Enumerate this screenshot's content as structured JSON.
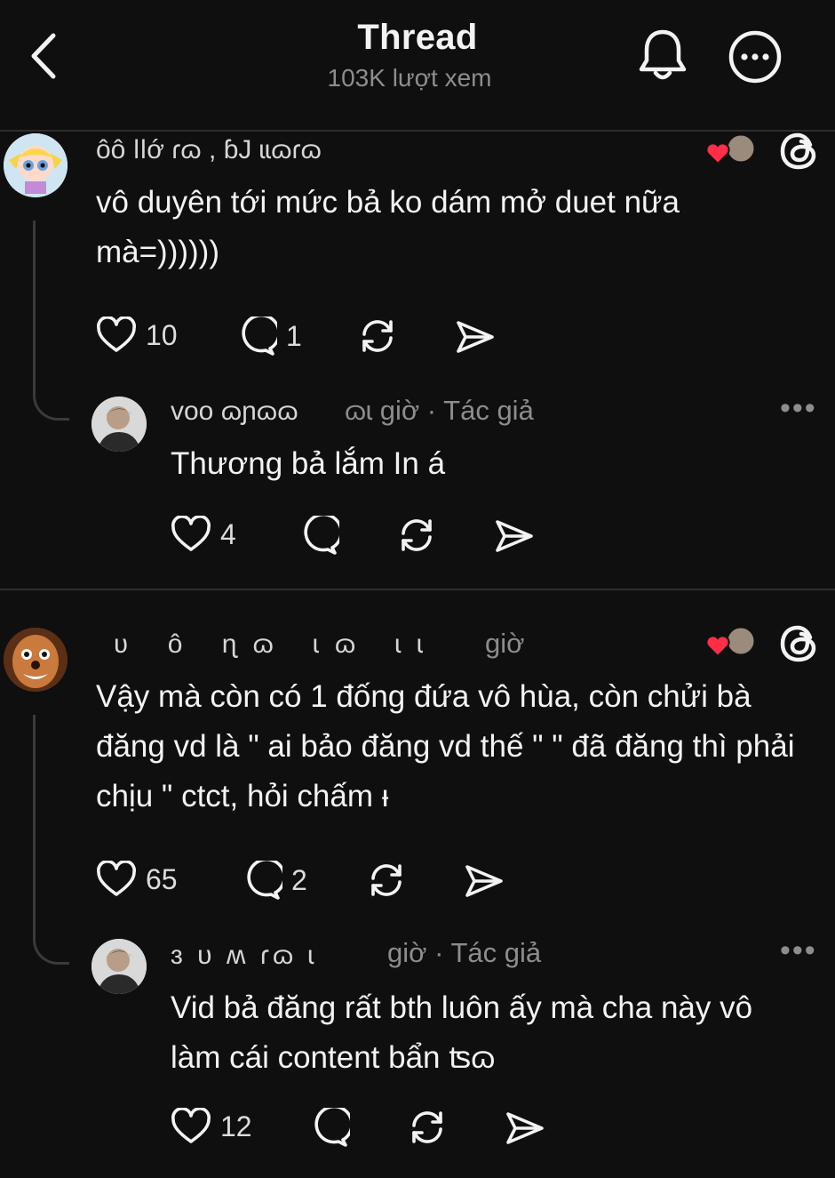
{
  "header": {
    "title": "Thread",
    "views": "103K lượt xem"
  },
  "comments": [
    {
      "username": "ôô ǀǀớ ɾɷ , ɓJ ɩɩɷɾɷ",
      "text": "vô duyên tới mức bả ko dám mở duet nữa mà=))))))",
      "likes": "10",
      "replies": "1",
      "reply": {
        "username": "voo ɷɲɷɷ",
        "time": "ɷɩ giờ · Tác giả",
        "text": "Thương bả lắm In á",
        "likes": "4"
      }
    },
    {
      "username": "ʋ ô ɳɷ ɩɷ ɩɩ",
      "time": "giờ",
      "text": "Vậy mà còn có 1 đống đứa vô hùa, còn chửi bà đăng vd là \" ai bảo đăng vd thế \" \" đã đăng thì phải chịu \" ctct, hỏi chấm ᵻ",
      "likes": "65",
      "replies": "2",
      "reply": {
        "username": "ɜ ᴜ ʍ ɾɷ ɩ",
        "time": "giờ · Tác giả",
        "text": "Vid bả đăng rất bth luôn ấy mà cha này vô làm cái content bẩn ʦɷ",
        "likes": "12"
      }
    }
  ],
  "colors": {
    "background": "#0f0f0f",
    "text": "#f3f3f3",
    "muted": "#8d8d8d",
    "heart": "#ff2d45"
  }
}
